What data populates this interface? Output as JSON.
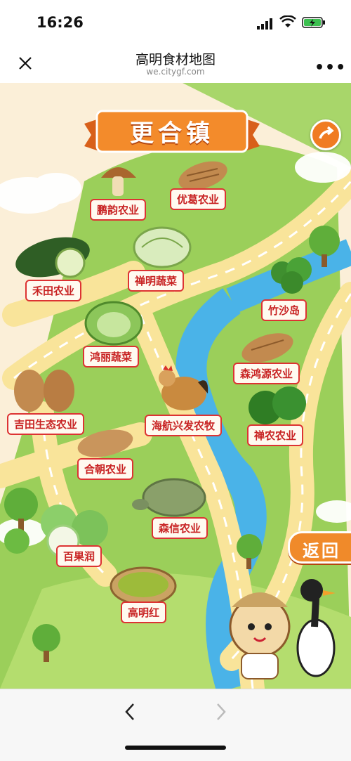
{
  "status_bar": {
    "time": "16:26"
  },
  "header": {
    "title": "高明食材地图",
    "domain": "we.citygf.com"
  },
  "map": {
    "town_title": "更合镇",
    "locations": [
      {
        "id": "pengyun",
        "label": "鹏韵农业"
      },
      {
        "id": "youge",
        "label": "优葛农业"
      },
      {
        "id": "hetian",
        "label": "禾田农业"
      },
      {
        "id": "chanming",
        "label": "禅明蔬菜"
      },
      {
        "id": "zhushadao",
        "label": "竹沙岛"
      },
      {
        "id": "hongli",
        "label": "鸿丽蔬菜"
      },
      {
        "id": "senhongyuan",
        "label": "森鸿源农业"
      },
      {
        "id": "jitian",
        "label": "吉田生态农业"
      },
      {
        "id": "haihang",
        "label": "海航兴发农牧"
      },
      {
        "id": "channong",
        "label": "禅农农业"
      },
      {
        "id": "hechao",
        "label": "合朝农业"
      },
      {
        "id": "senxin",
        "label": "森信农业"
      },
      {
        "id": "baiguorun",
        "label": "百果润"
      },
      {
        "id": "gaominghong",
        "label": "高明红"
      }
    ],
    "back_label": "返回"
  }
}
